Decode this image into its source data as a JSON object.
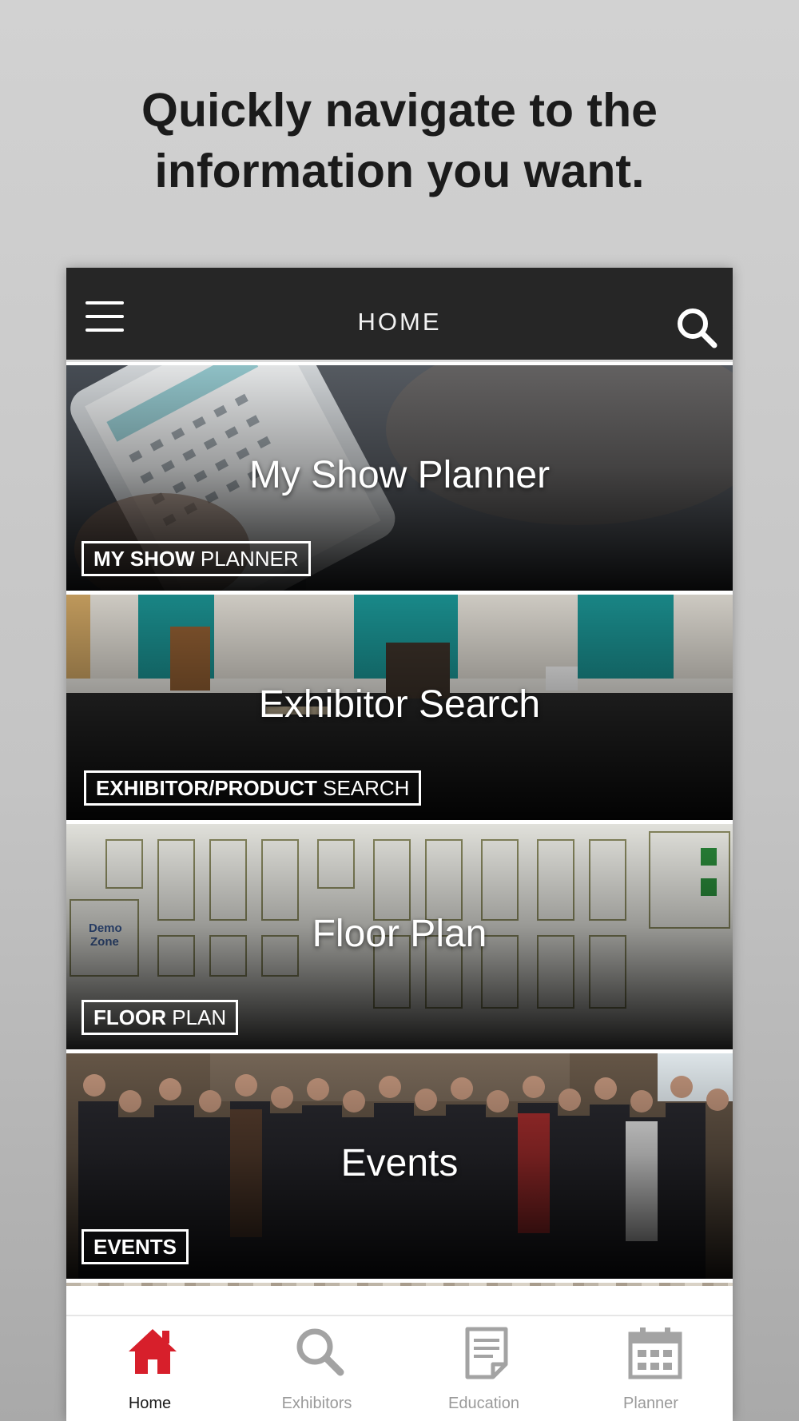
{
  "headline": {
    "line1": "Quickly navigate to the",
    "line2": "information you want."
  },
  "topbar": {
    "title": "HOME",
    "menu_icon": "hamburger-menu-icon",
    "search_icon": "search-icon"
  },
  "tiles": [
    {
      "title": "My Show Planner",
      "badge_bold": "MY SHOW",
      "badge_light": " PLANNER"
    },
    {
      "title": "Exhibitor Search",
      "badge_bold": "EXHIBITOR/PRODUCT",
      "badge_light": " SEARCH"
    },
    {
      "title": "Floor Plan",
      "badge_bold": "FLOOR",
      "badge_light": " PLAN"
    },
    {
      "title": "Events",
      "badge_bold": "EVENTS",
      "badge_light": ""
    }
  ],
  "tabbar": {
    "items": [
      {
        "label": "Home",
        "icon": "home-icon",
        "active": true
      },
      {
        "label": "Exhibitors",
        "icon": "search-icon",
        "active": false
      },
      {
        "label": "Education",
        "icon": "document-icon",
        "active": false
      },
      {
        "label": "Planner",
        "icon": "calendar-icon",
        "active": false
      }
    ]
  },
  "colors": {
    "accent": "#d71f2b",
    "topbar": "#262626",
    "inactive_tab": "#9a9a9a"
  }
}
